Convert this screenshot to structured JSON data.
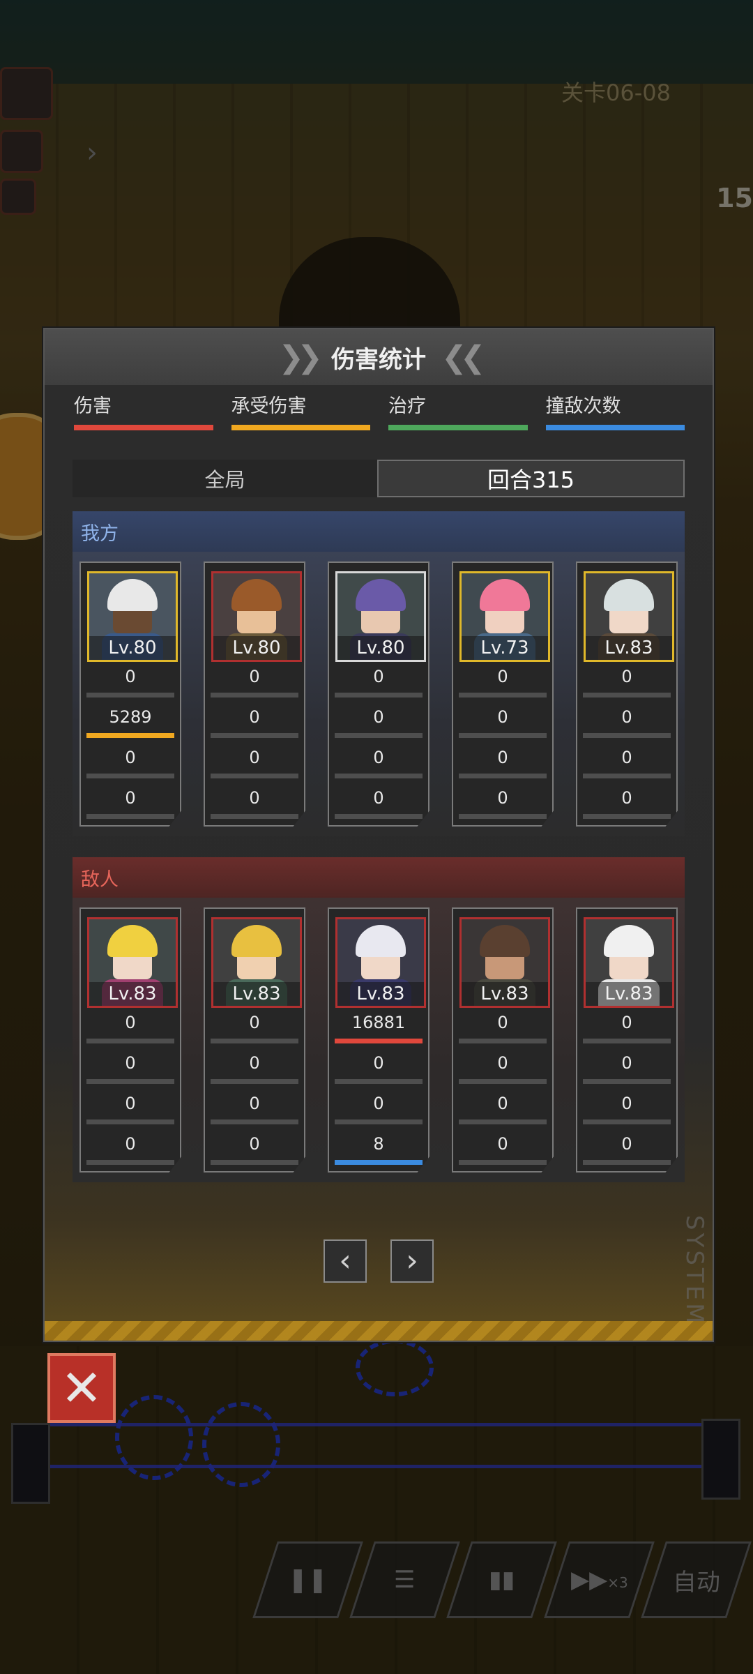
{
  "stage_label": "关卡06-08",
  "side_number": "15",
  "dialog": {
    "title": "伤害统计",
    "tabs": [
      {
        "label": "伤害",
        "color": "#e0483c"
      },
      {
        "label": "承受伤害",
        "color": "#f0a820"
      },
      {
        "label": "治疗",
        "color": "#4ea85c"
      },
      {
        "label": "撞敌次数",
        "color": "#3b8be0"
      }
    ],
    "scope": {
      "all": "全局",
      "round": "回合315"
    },
    "ally": {
      "label": "我方",
      "units": [
        {
          "level": "Lv.80",
          "stats": [
            "0",
            "5289",
            "0",
            "0"
          ],
          "highlight": [
            null,
            "orange",
            null,
            null
          ]
        },
        {
          "level": "Lv.80",
          "stats": [
            "0",
            "0",
            "0",
            "0"
          ],
          "highlight": [
            null,
            null,
            null,
            null
          ]
        },
        {
          "level": "Lv.80",
          "stats": [
            "0",
            "0",
            "0",
            "0"
          ],
          "highlight": [
            null,
            null,
            null,
            null
          ]
        },
        {
          "level": "Lv.73",
          "stats": [
            "0",
            "0",
            "0",
            "0"
          ],
          "highlight": [
            null,
            null,
            null,
            null
          ]
        },
        {
          "level": "Lv.83",
          "stats": [
            "0",
            "0",
            "0",
            "0"
          ],
          "highlight": [
            null,
            null,
            null,
            null
          ]
        }
      ]
    },
    "enemy": {
      "label": "敌人",
      "units": [
        {
          "level": "Lv.83",
          "stats": [
            "0",
            "0",
            "0",
            "0"
          ],
          "highlight": [
            null,
            null,
            null,
            null
          ]
        },
        {
          "level": "Lv.83",
          "stats": [
            "0",
            "0",
            "0",
            "0"
          ],
          "highlight": [
            null,
            null,
            null,
            null
          ]
        },
        {
          "level": "Lv.83",
          "stats": [
            "16881",
            "0",
            "0",
            "8"
          ],
          "highlight": [
            "red",
            null,
            null,
            "blue"
          ]
        },
        {
          "level": "Lv.83",
          "stats": [
            "0",
            "0",
            "0",
            "0"
          ],
          "highlight": [
            null,
            null,
            null,
            null
          ]
        },
        {
          "level": "Lv.83",
          "stats": [
            "0",
            "0",
            "0",
            "0"
          ],
          "highlight": [
            null,
            null,
            null,
            null
          ]
        }
      ]
    },
    "pager": {
      "prev_icon": "chevron-left-icon",
      "next_icon": "chevron-right-icon"
    },
    "watermark": "SYSTEM"
  },
  "close_icon": "close-icon",
  "bottom_buttons": [
    {
      "icon": "pause-icon"
    },
    {
      "icon": "team-icon"
    },
    {
      "icon": "stats-icon"
    },
    {
      "icon": "speed-icon",
      "label": "×3"
    },
    {
      "label": "自动"
    }
  ]
}
